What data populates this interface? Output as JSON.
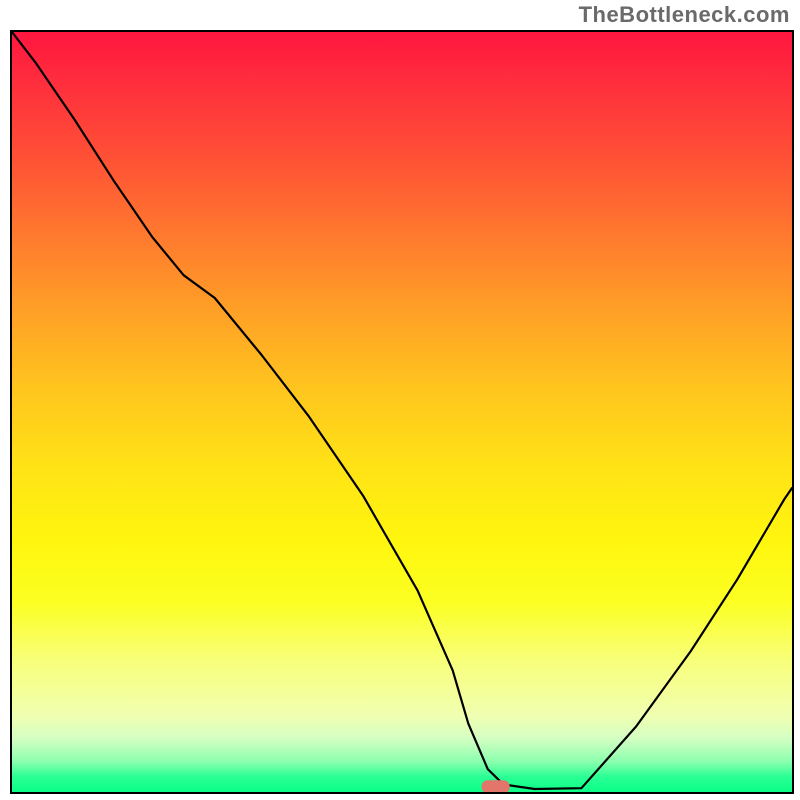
{
  "watermark": "TheBottleneck.com",
  "colors": {
    "border": "#000000",
    "curve": "#000000",
    "marker": "#e2766a",
    "gradient_top": "#ff163f",
    "gradient_bottom": "#0aff87"
  },
  "chart_data": {
    "type": "line",
    "title": "",
    "xlabel": "",
    "ylabel": "",
    "xlim": [
      0,
      100
    ],
    "ylim": [
      0,
      100
    ],
    "x": [
      0,
      3,
      8,
      13,
      18,
      22,
      26,
      32,
      38,
      45,
      52,
      56.5,
      58.5,
      61,
      63,
      67,
      73,
      80,
      87,
      93,
      99,
      100
    ],
    "y": [
      100,
      96,
      88.5,
      80.5,
      73,
      68,
      65,
      57.5,
      49.5,
      39,
      26.5,
      16,
      9,
      3,
      1,
      0.4,
      0.5,
      8.6,
      18.5,
      28,
      38.5,
      40
    ],
    "marker": {
      "x": 62,
      "y": 0.7,
      "shape": "rounded-rect"
    },
    "annotations": [],
    "legend": null
  }
}
